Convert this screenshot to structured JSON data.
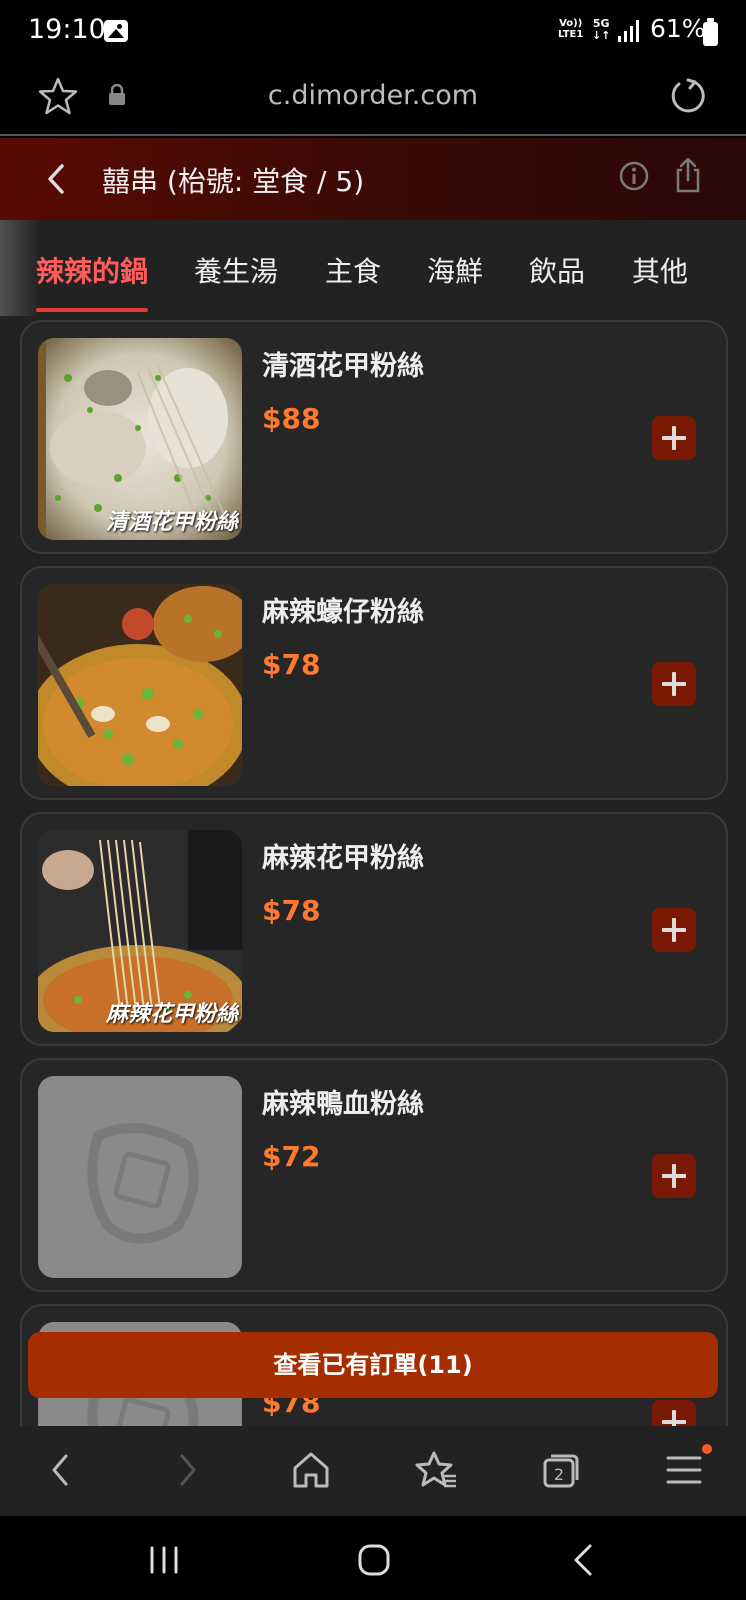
{
  "status_bar": {
    "time": "19:10",
    "volte": "Vo)) LTE1",
    "network": "5G",
    "battery": "61%"
  },
  "url_bar": {
    "url": "c.dimorder.com"
  },
  "header": {
    "title": "囍串 (枱號: 堂食 / 5)"
  },
  "tabs": [
    {
      "label": "辣辣的鍋",
      "active": true
    },
    {
      "label": "養生湯",
      "active": false
    },
    {
      "label": "主食",
      "active": false
    },
    {
      "label": "海鮮",
      "active": false
    },
    {
      "label": "飲品",
      "active": false
    },
    {
      "label": "其他",
      "active": false
    }
  ],
  "menu_items": [
    {
      "name": "清酒花甲粉絲",
      "price": "$88",
      "image_caption": "清酒花甲粉絲"
    },
    {
      "name": "麻辣蠔仔粉絲",
      "price": "$78",
      "image_caption": ""
    },
    {
      "name": "麻辣花甲粉絲",
      "price": "$78",
      "image_caption": "麻辣花甲粉絲"
    },
    {
      "name": "麻辣鴨血粉絲",
      "price": "$72",
      "image_caption": ""
    },
    {
      "name": "",
      "price": "$78",
      "image_caption": ""
    }
  ],
  "view_orders_label": "查看已有訂單(11)",
  "colors": {
    "accent": "#ff7a2f",
    "active_tab": "#ff5c5c",
    "order_bar": "#a52d00",
    "add_button": "#7a1a05"
  },
  "icons": {
    "browser_nav": [
      "back-arrow-icon",
      "forward-arrow-icon",
      "home-icon",
      "bookmarks-icon",
      "tabs-icon",
      "menu-icon"
    ],
    "tab_count": "2"
  }
}
